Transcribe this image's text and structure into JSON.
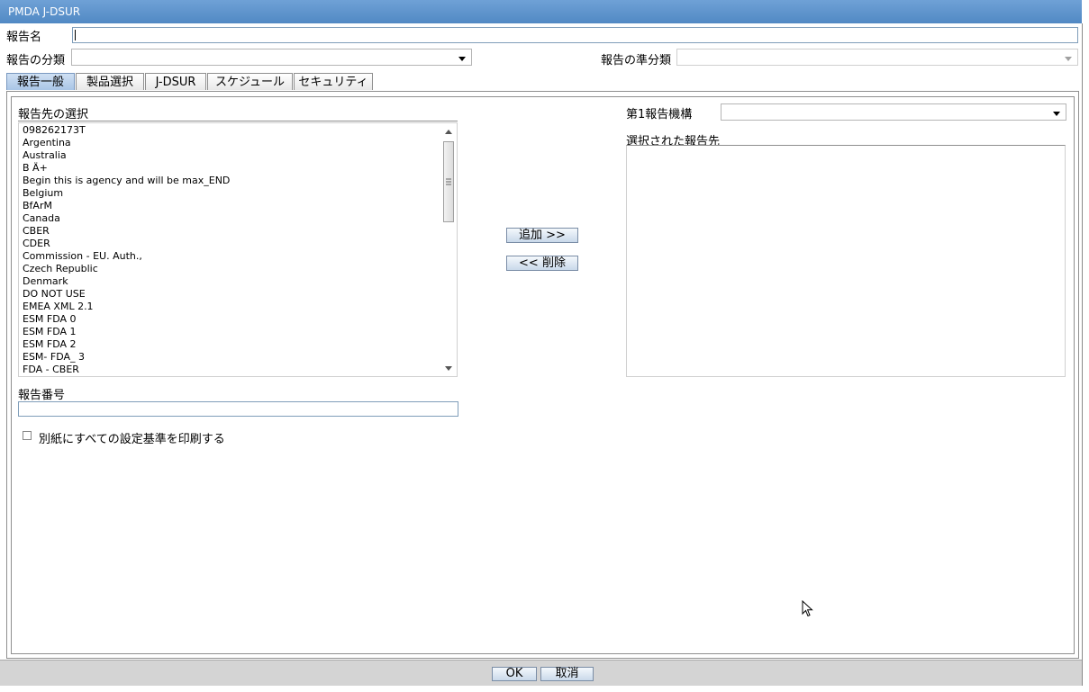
{
  "window": {
    "title": "PMDA J-DSUR"
  },
  "form": {
    "report_name_label": "報告名",
    "report_name_value": "",
    "category_label": "報告の分類",
    "category_value": "",
    "subcategory_label": "報告の準分類",
    "subcategory_value": ""
  },
  "tabs": [
    {
      "label": "報告一般",
      "active": true
    },
    {
      "label": "製品選択"
    },
    {
      "label": "J-DSUR"
    },
    {
      "label": "スケジュール"
    },
    {
      "label": "セキュリティ"
    }
  ],
  "destinations": {
    "title": "報告先の選択",
    "items": [
      "098262173T",
      "Argentina",
      "Australia",
      "B Ä+",
      "Begin this is agency and will be max_END",
      "Belgium",
      "BfArM",
      "Canada",
      "CBER",
      "CDER",
      "Commission - EU. Auth.,",
      "Czech Republic",
      "Denmark",
      "DO NOT USE",
      "EMEA XML 2.1",
      "ESM FDA 0",
      "ESM FDA 1",
      "ESM FDA 2",
      "ESM- FDA_ 3",
      "FDA - CBER"
    ]
  },
  "buttons": {
    "add": "追加 >>",
    "remove": "<< 削除",
    "ok": "OK",
    "cancel": "取消"
  },
  "primary_agency": {
    "label": "第1報告機構",
    "value": ""
  },
  "selected": {
    "title": "選択された報告先",
    "items": []
  },
  "report_number": {
    "label": "報告番号",
    "value": ""
  },
  "print_option": {
    "label": "別紙にすべての設定基準を印刷する",
    "checked": false
  },
  "colors": {
    "titlebar": "#5b8fc9",
    "active_tab": "#b4cce9",
    "footer": "#d4d4d4"
  }
}
